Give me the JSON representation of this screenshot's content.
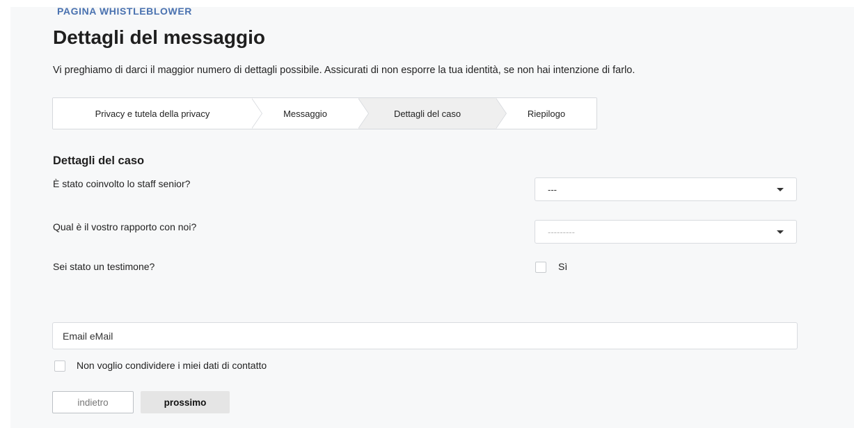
{
  "header": {
    "eyebrow": "PAGINA WHISTLEBLOWER",
    "title": "Dettagli del messaggio",
    "intro": "Vi preghiamo di darci il maggior numero di dettagli possibile. Assicurati di non esporre la tua identità, se non hai intenzione di farlo."
  },
  "stepper": {
    "steps": [
      {
        "label": "Privacy e tutela della privacy"
      },
      {
        "label": "Messaggio"
      },
      {
        "label": "Dettagli del caso",
        "active": true
      },
      {
        "label": "Riepilogo"
      }
    ]
  },
  "form": {
    "section_title": "Dettagli del caso",
    "senior_staff": {
      "question": "È stato coinvolto lo staff senior?",
      "value": "---"
    },
    "relationship": {
      "question": "Qual è il vostro rapporto con noi?",
      "value": "---------"
    },
    "witness": {
      "question": "Sei stato un testimone?",
      "option_label": "Sì",
      "checked": false
    },
    "email": {
      "placeholder": "Email eMail",
      "value": ""
    },
    "no_contact": {
      "label": "Non voglio condividere i miei dati di contatto",
      "checked": false
    }
  },
  "buttons": {
    "back_label": "indietro",
    "next_label": "prossimo"
  }
}
